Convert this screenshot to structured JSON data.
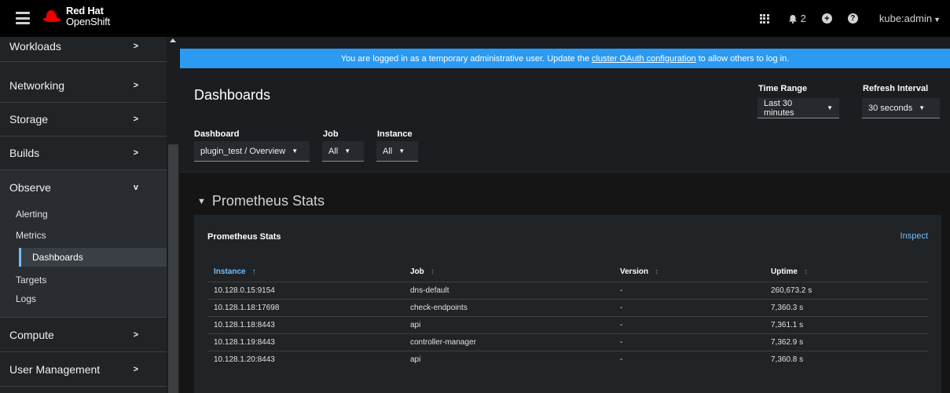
{
  "masthead": {
    "brand_line1": "Red Hat",
    "brand_line2": "OpenShift",
    "notification_count": "2",
    "user": "kube:admin"
  },
  "sidebar": {
    "groups": [
      {
        "label": "Workloads"
      },
      {
        "label": "Networking"
      },
      {
        "label": "Storage"
      },
      {
        "label": "Builds"
      },
      {
        "label": "Observe"
      },
      {
        "label": "Compute"
      },
      {
        "label": "User Management"
      }
    ],
    "observe_items": [
      {
        "label": "Alerting"
      },
      {
        "label": "Metrics"
      },
      {
        "label": "Dashboards"
      },
      {
        "label": "Targets"
      },
      {
        "label": "Logs"
      }
    ]
  },
  "banner": {
    "text_before": "You are logged in as a temporary administrative user. Update the",
    "link": "cluster OAuth configuration",
    "text_after": "to allow others to log in."
  },
  "header": {
    "title": "Dashboards",
    "dashboard_label": "Dashboard",
    "dashboard_value": "plugin_test / Overview",
    "job_label": "Job",
    "job_value": "All",
    "instance_label": "Instance",
    "instance_value": "All",
    "time_range_label": "Time Range",
    "time_range_value": "Last 30 minutes",
    "refresh_label": "Refresh Interval",
    "refresh_value": "30 seconds"
  },
  "section": {
    "title": "Prometheus Stats"
  },
  "card": {
    "title": "Prometheus Stats",
    "inspect": "Inspect",
    "columns": [
      "Instance",
      "Job",
      "Version",
      "Uptime"
    ],
    "rows": [
      [
        "10.128.0.15:9154",
        "dns-default",
        "-",
        "260,673.2 s"
      ],
      [
        "10.128.1.18:17698",
        "check-endpoints",
        "-",
        "7,360.3 s"
      ],
      [
        "10.128.1.18:8443",
        "api",
        "-",
        "7,361.1 s"
      ],
      [
        "10.128.1.19:8443",
        "controller-manager",
        "-",
        "7,362.9 s"
      ],
      [
        "10.128.1.20:8443",
        "api",
        "-",
        "7,360.8 s"
      ]
    ]
  },
  "colors": {
    "accent": "#73bcf7",
    "banner": "#2b9af3",
    "brand_red": "#ee0000"
  }
}
